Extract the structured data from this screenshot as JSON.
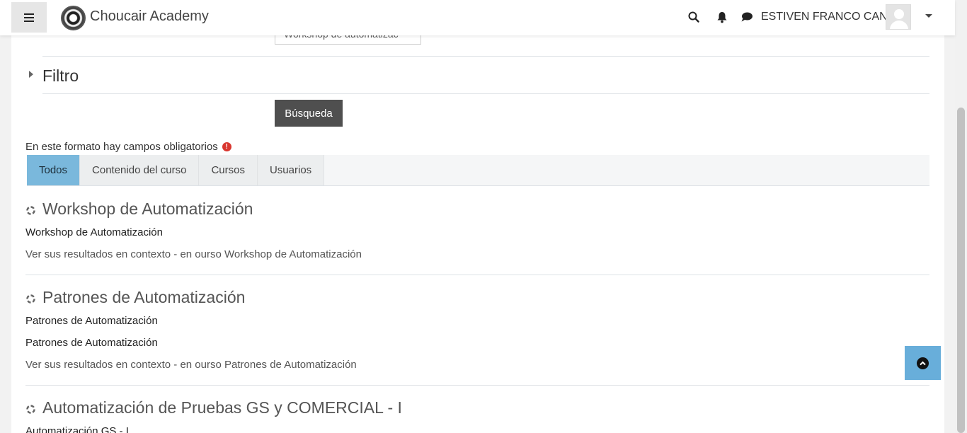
{
  "navbar": {
    "brand": "Choucair Academy",
    "user_name": "ESTIVEN FRANCO CANO",
    "icons": [
      "menu-icon",
      "search-icon",
      "bell-icon",
      "chat-icon",
      "avatar",
      "chevron-down-icon"
    ]
  },
  "form": {
    "previous_field_value": "Workshop de automatizac",
    "filter_section": "Filtro",
    "search_button": "Búsqueda",
    "required_note": "En este formato hay campos obligatorios",
    "required_icon": "exclamation-circle-icon"
  },
  "tabs": [
    {
      "label": "Todos",
      "active": true
    },
    {
      "label": "Contenido del curso",
      "active": false
    },
    {
      "label": "Cursos",
      "active": false
    },
    {
      "label": "Usuarios",
      "active": false
    }
  ],
  "results": [
    {
      "title": "Workshop de Automatización",
      "lines": [
        "Workshop de Automatización"
      ],
      "context": "Ver sus resultados en contexto - en ourso Workshop de Automatización"
    },
    {
      "title": "Patrones de Automatización",
      "lines": [
        "Patrones de Automatización",
        "Patrones de Automatización"
      ],
      "context": "Ver sus resultados en contexto - en ourso Patrones de Automatización"
    },
    {
      "title": "Automatización de Pruebas GS y COMERCIAL - I",
      "lines": [
        "Automatización GS - I"
      ],
      "context": ""
    }
  ],
  "colors": {
    "active_tab": "#7ab8dc",
    "search_button": "#4f4f4f",
    "back_to_top": "#68aeda",
    "required_icon": "#d9362f"
  }
}
